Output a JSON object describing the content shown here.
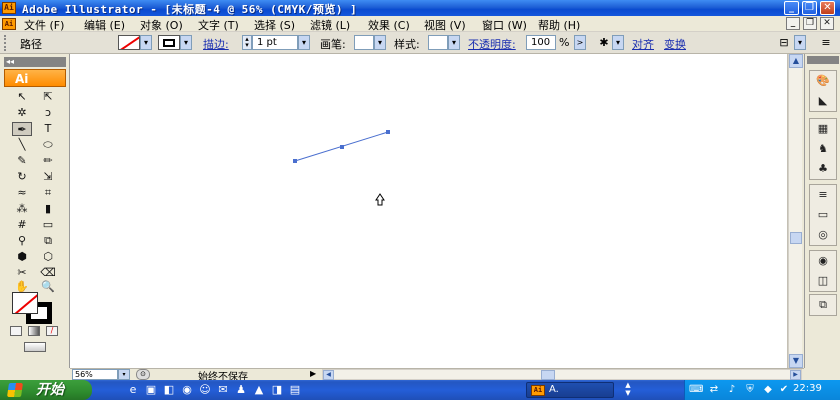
{
  "window": {
    "app_icon": "Ai",
    "title": "Adobe Illustrator - [未标题-4 @ 56% (CMYK/预览) ]",
    "minimize_label": "_",
    "maximize_label": "❐",
    "close_label": "✕"
  },
  "menu": {
    "doc_icon": "Ai",
    "items": [
      {
        "label": "文件 (F)"
      },
      {
        "label": "编辑 (E)"
      },
      {
        "label": "对象 (O)"
      },
      {
        "label": "文字 (T)"
      },
      {
        "label": "选择 (S)"
      },
      {
        "label": "滤镜 (L)"
      },
      {
        "label": "效果 (C)"
      },
      {
        "label": "视图 (V)"
      },
      {
        "label": "窗口 (W)"
      },
      {
        "label": "帮助 (H)"
      }
    ],
    "doc_minimize": "_",
    "doc_restore": "❐",
    "doc_close": "✕"
  },
  "control_bar": {
    "selection_type": "路径",
    "stroke_weight_label": "描边:",
    "stroke_weight_value": "1 pt",
    "brush_label": "画笔:",
    "style_label": "样式:",
    "opacity_label": "不透明度:",
    "opacity_value": "100",
    "percent_symbol": ">",
    "align_label": "对齐",
    "transform_label": "变换"
  },
  "toolbox": {
    "badge": "Ai",
    "tools": [
      {
        "icon": "selection-icon",
        "glyph": "↖"
      },
      {
        "icon": "direct-selection-icon",
        "glyph": "⇱"
      },
      {
        "icon": "magic-wand-icon",
        "glyph": "✲"
      },
      {
        "icon": "lasso-icon",
        "glyph": "ↄ"
      },
      {
        "icon": "pen-icon",
        "glyph": "✒"
      },
      {
        "icon": "type-icon",
        "glyph": "T"
      },
      {
        "icon": "line-segment-icon",
        "glyph": "╲"
      },
      {
        "icon": "ellipse-icon",
        "glyph": "⬭"
      },
      {
        "icon": "paintbrush-icon",
        "glyph": "✎"
      },
      {
        "icon": "pencil-icon",
        "glyph": "✏"
      },
      {
        "icon": "rotate-icon",
        "glyph": "↻"
      },
      {
        "icon": "scale-icon",
        "glyph": "⇲"
      },
      {
        "icon": "warp-icon",
        "glyph": "≈"
      },
      {
        "icon": "free-transform-icon",
        "glyph": "⌗"
      },
      {
        "icon": "symbol-sprayer-icon",
        "glyph": "⁂"
      },
      {
        "icon": "column-graph-icon",
        "glyph": "▮"
      },
      {
        "icon": "mesh-icon",
        "glyph": "#"
      },
      {
        "icon": "gradient-icon",
        "glyph": "▭"
      },
      {
        "icon": "eyedropper-icon",
        "glyph": "⚲"
      },
      {
        "icon": "blend-icon",
        "glyph": "⧉"
      },
      {
        "icon": "live-paint-bucket-icon",
        "glyph": "⬢"
      },
      {
        "icon": "live-paint-selection-icon",
        "glyph": "⬡"
      },
      {
        "icon": "slice-icon",
        "glyph": "✂"
      },
      {
        "icon": "eraser-icon",
        "glyph": "⌫"
      },
      {
        "icon": "hand-icon",
        "glyph": "✋"
      },
      {
        "icon": "zoom-icon",
        "glyph": "🔍"
      }
    ]
  },
  "status_bar": {
    "zoom": "56%",
    "zoom_dropdown": "▾",
    "status_text": "始终不保存",
    "status_arrow": "▶"
  },
  "taskbar": {
    "start_label": "开始",
    "task_icon": "Ai",
    "task_label": "A.",
    "clock": "22:39"
  },
  "colors": {
    "title_bar": "#1e60d6",
    "path_stroke": "#4a6fcf",
    "fill_none_slash": "#e00000",
    "ai_badge": "#ff8c00"
  },
  "icons": {
    "pen_cursor": "pen-cursor-icon"
  }
}
